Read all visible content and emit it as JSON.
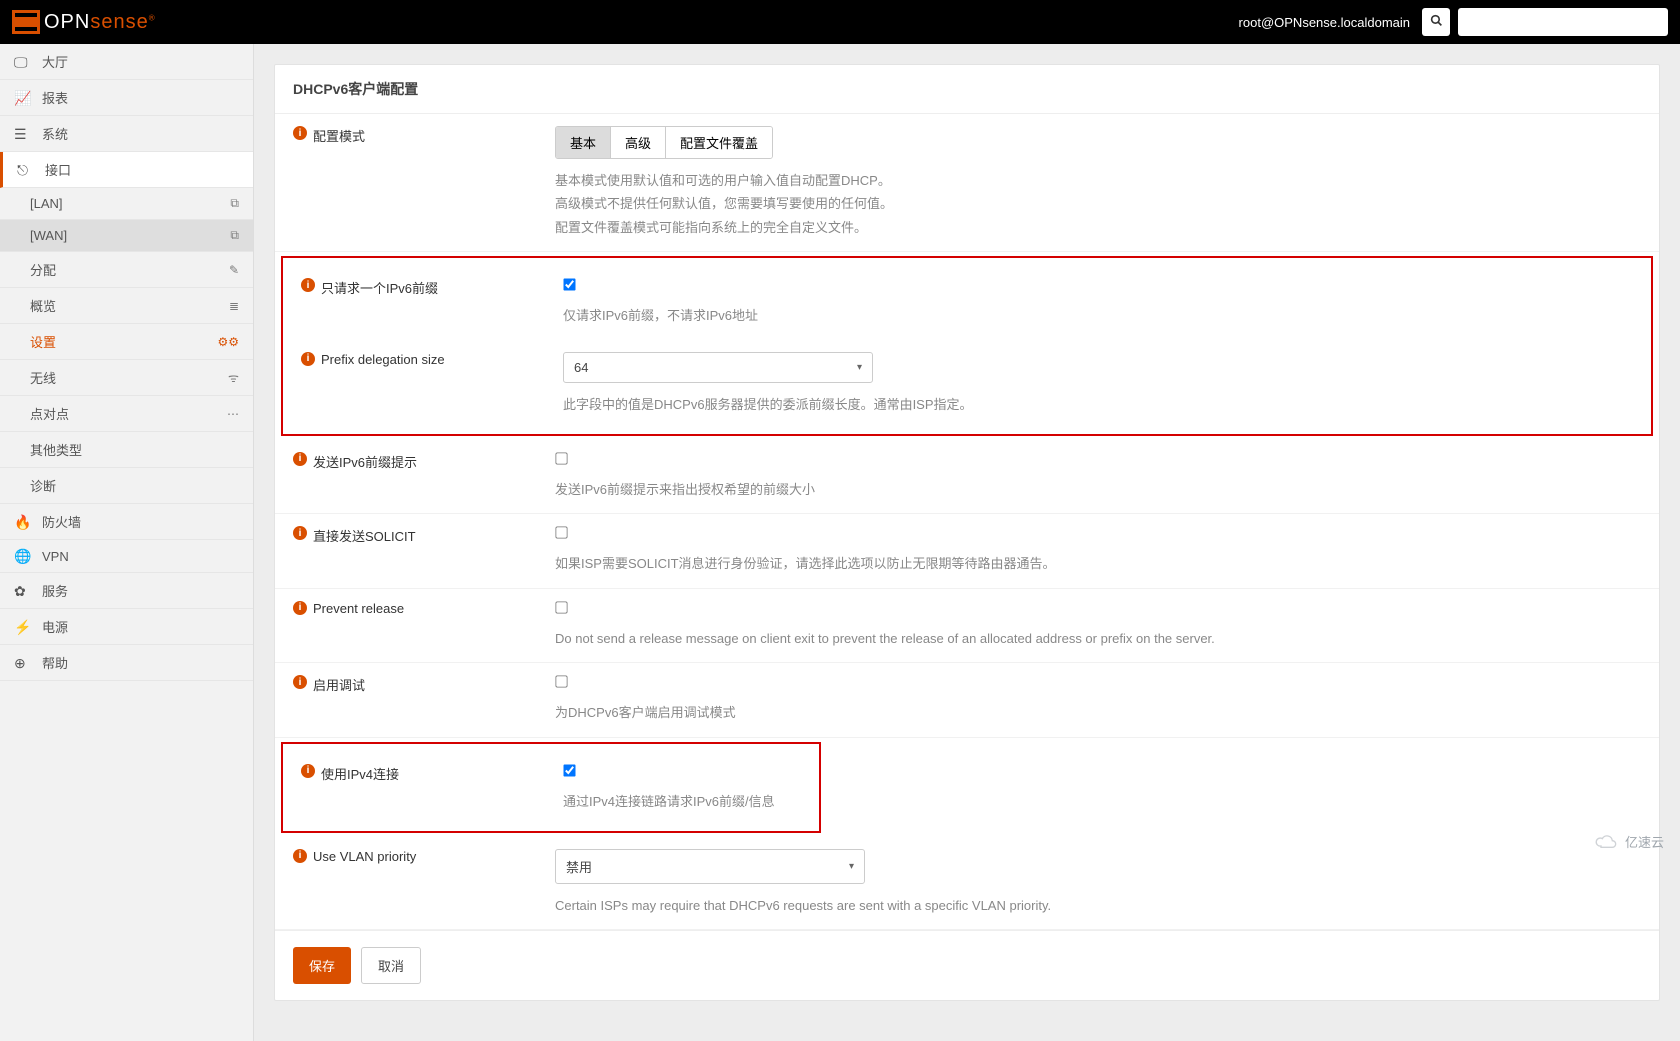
{
  "header": {
    "logo_part1": "OPN",
    "logo_part2": "sense",
    "user_line": "root@OPNsense.localdomain",
    "search_placeholder": ""
  },
  "sidebar": {
    "top": [
      {
        "icon": "▢",
        "label": "大厅"
      },
      {
        "icon": "▂",
        "label": "报表"
      },
      {
        "icon": "≡",
        "label": "系统"
      }
    ],
    "interfaces_label": "接口",
    "interfaces": [
      {
        "label": "[LAN]",
        "right": "sitemap"
      },
      {
        "label": "[WAN]",
        "right": "sitemap",
        "selected": true
      },
      {
        "label": "分配",
        "right": "pencil"
      },
      {
        "label": "概览",
        "right": "list"
      },
      {
        "label": "设置",
        "right": "gears",
        "orange": true
      },
      {
        "label": "无线",
        "right": "wifi"
      },
      {
        "label": "点对点",
        "right": "dots"
      },
      {
        "label": "其他类型",
        "right": ""
      },
      {
        "label": "诊断",
        "right": ""
      }
    ],
    "bottom": [
      {
        "icon": "🔥",
        "label": "防火墙"
      },
      {
        "icon": "🌐",
        "label": "VPN"
      },
      {
        "icon": "⚙",
        "label": "服务"
      },
      {
        "icon": "🔌",
        "label": "电源"
      },
      {
        "icon": "⊕",
        "label": "帮助"
      }
    ]
  },
  "card": {
    "title": "DHCPv6客户端配置",
    "rows": {
      "config_mode": {
        "label": "配置模式",
        "tabs": {
          "basic": "基本",
          "advanced": "高级",
          "file_overwrite": "配置文件覆盖"
        },
        "help1": "基本模式使用默认值和可选的用户输入值自动配置DHCP。",
        "help2": "高级模式不提供任何默认值，您需要填写要使用的任何值。",
        "help3": "配置文件覆盖模式可能指向系统上的完全自定义文件。"
      },
      "only_prefix": {
        "label": "只请求一个IPv6前缀",
        "checked": true,
        "help": "仅请求IPv6前缀，不请求IPv6地址"
      },
      "pd_size": {
        "label": "Prefix delegation size",
        "value": "64",
        "help": "此字段中的值是DHCPv6服务器提供的委派前缀长度。通常由ISP指定。"
      },
      "send_hint": {
        "label": "发送IPv6前缀提示",
        "checked": false,
        "help": "发送IPv6前缀提示来指出授权希望的前缀大小"
      },
      "send_solicit": {
        "label": "直接发送SOLICIT",
        "checked": false,
        "help": "如果ISP需要SOLICIT消息进行身份验证，请选择此选项以防止无限期等待路由器通告。"
      },
      "prevent_release": {
        "label": "Prevent release",
        "checked": false,
        "help": "Do not send a release message on client exit to prevent the release of an allocated address or prefix on the server."
      },
      "enable_debug": {
        "label": "启用调试",
        "checked": false,
        "help": "为DHCPv6客户端启用调试模式"
      },
      "use_ipv4": {
        "label": "使用IPv4连接",
        "checked": true,
        "help": "通过IPv4连接链路请求IPv6前缀/信息"
      },
      "vlan_prio": {
        "label": "Use VLAN priority",
        "value": "禁用",
        "help": "Certain ISPs may require that DHCPv6 requests are sent with a specific VLAN priority."
      }
    },
    "actions": {
      "save": "保存",
      "cancel": "取消"
    }
  },
  "watermark": "亿速云"
}
